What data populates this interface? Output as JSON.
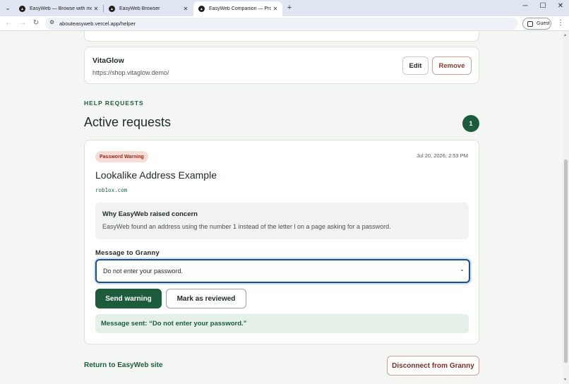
{
  "browser": {
    "tabs": [
      {
        "title": "EasyWeb — Browse with more",
        "active": false
      },
      {
        "title": "EasyWeb Browser",
        "active": false
      },
      {
        "title": "EasyWeb Companion — Protot",
        "active": true
      }
    ],
    "new_tab": "+",
    "window_controls": {
      "minimize": "─",
      "maximize": "☐",
      "close": "✕"
    },
    "url": "abouteasyweb.vercel.app/helper",
    "profile_label": "Guest"
  },
  "site_card": {
    "name": "VitaGlow",
    "url": "https://shop.vitaglow.demo/",
    "edit_label": "Edit",
    "remove_label": "Remove"
  },
  "help_requests": {
    "section_label": "HELP REQUESTS",
    "title": "Active requests",
    "count": "1"
  },
  "request": {
    "badge": "Password Warning",
    "timestamp": "Jul 20, 2026, 2:53 PM",
    "title": "Lookalike Address Example",
    "domain": "rob1ox.com",
    "concern_title": "Why EasyWeb raised concern",
    "concern_text": "EasyWeb found an address using the number 1 instead of the letter l on a page asking for a password.",
    "message_label": "Message to Granny",
    "message_selected": "Do not enter your password.",
    "send_label": "Send warning",
    "review_label": "Mark as reviewed",
    "sent_status": "Message sent: “Do not enter your password.”"
  },
  "footer": {
    "return_link": "Return to EasyWeb site",
    "disconnect_label": "Disconnect from Granny"
  },
  "colors": {
    "brand_green": "#1c5c3d",
    "warning_bg": "#f8dcd6",
    "focus_ring": "#1a4f8a"
  }
}
